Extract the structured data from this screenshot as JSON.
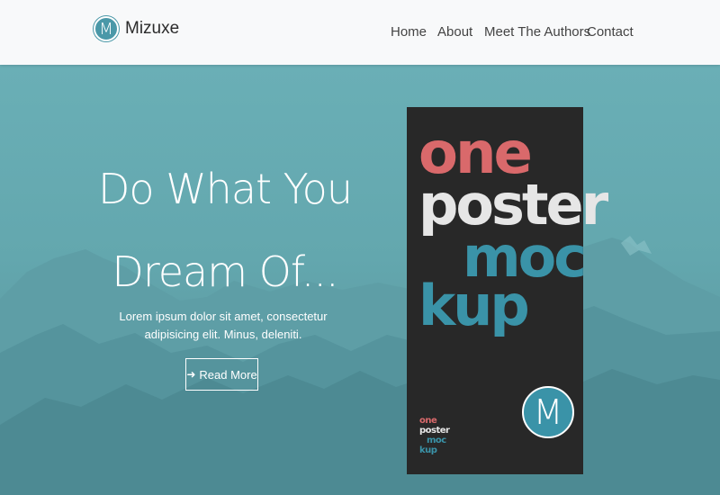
{
  "navbar": {
    "brand_logo_letter": "M",
    "brand_name": "Mizuxe",
    "links": [
      {
        "label": "Home"
      },
      {
        "label": "About"
      },
      {
        "label": "Meet The Authors"
      },
      {
        "label": "Contact"
      }
    ]
  },
  "hero": {
    "headline_line1": "Do What You",
    "headline_line2": "Dream Of...",
    "lead": "Lorem ipsum dolor sit amet, consectetur adipisicing elit. Minus, deleniti.",
    "button_label": "Read More",
    "button_icon": "arrow-right-icon"
  },
  "poster": {
    "words": [
      "one",
      "poster",
      "moc",
      "kup"
    ],
    "small_words": [
      "one",
      "poster",
      "moc",
      "kup"
    ],
    "logo_letter": "M",
    "colors": {
      "one": "#d9696b",
      "poster": "#e6e6e6",
      "mockup": "#3a93a8",
      "background": "#282828"
    }
  },
  "colors": {
    "accent": "#4a98a8",
    "hero_tint": "#6aa7ad",
    "navbar_bg": "#f8f9fa"
  }
}
